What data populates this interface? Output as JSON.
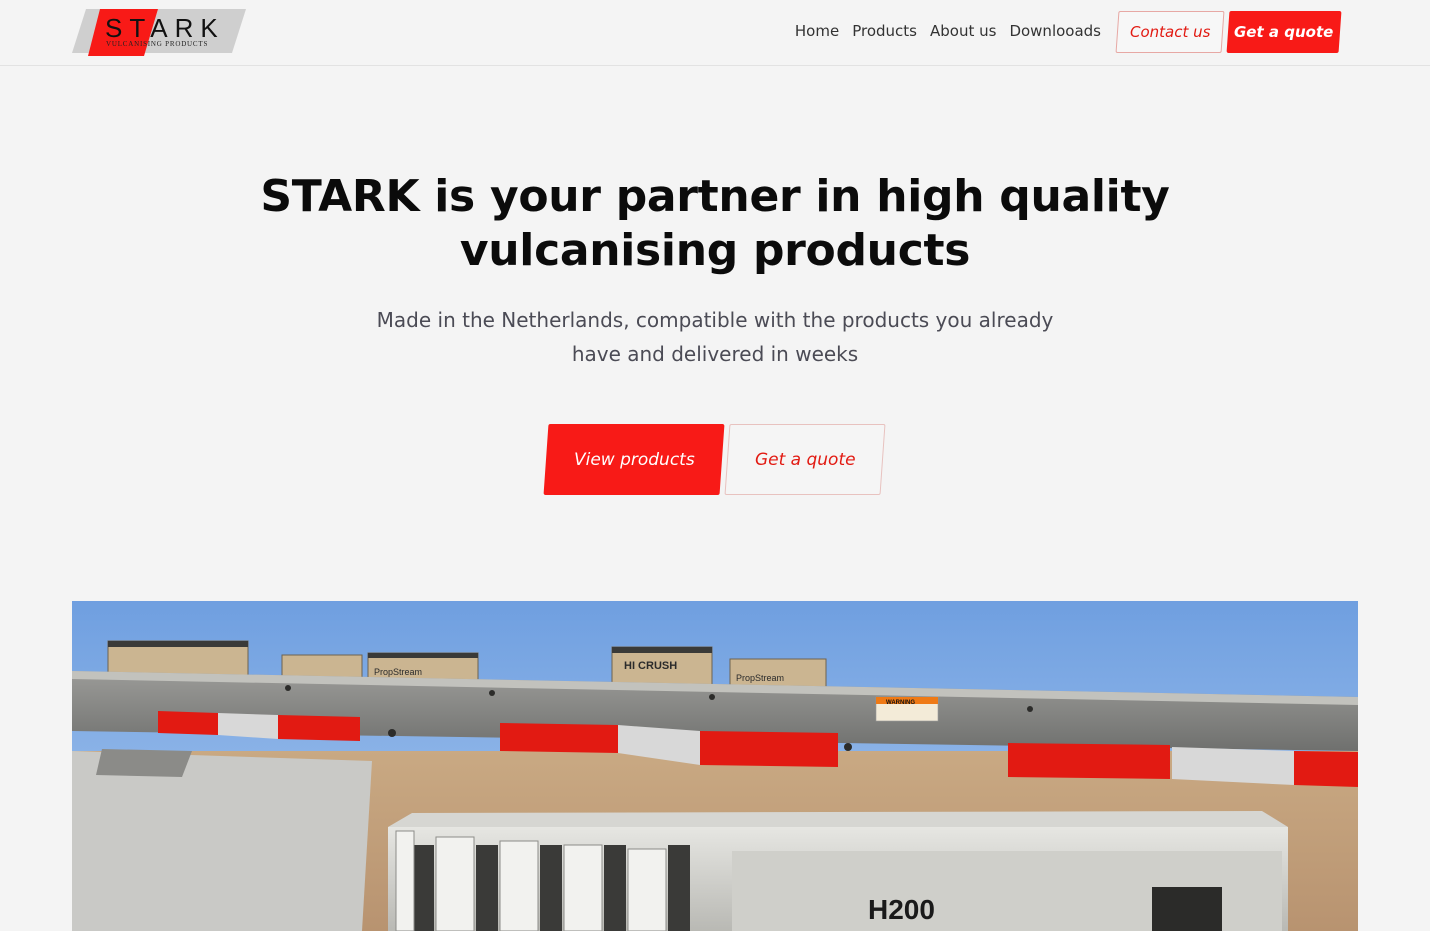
{
  "brand": {
    "name": "STARK",
    "tagline": "VULCANISING PRODUCTS",
    "accent": "#f81a17"
  },
  "nav": {
    "items": [
      "Home",
      "Products",
      "About us",
      "Downlooads"
    ]
  },
  "header_buttons": {
    "contact": "Contact us",
    "quote": "Get a quote"
  },
  "hero": {
    "title_line1": "STARK is your partner in high quality",
    "title_line2": "vulcanising products",
    "subtitle_line1": "Made in the Netherlands, compatible with the products you already",
    "subtitle_line2": "have and delivered in weeks",
    "primary_button": "View products",
    "secondary_button": "Get a quote"
  },
  "image": {
    "warning_label": "WARNING",
    "crate_label_1": "HI CRUSH",
    "crate_label_2": "PropStream",
    "machine_label": "H200"
  }
}
